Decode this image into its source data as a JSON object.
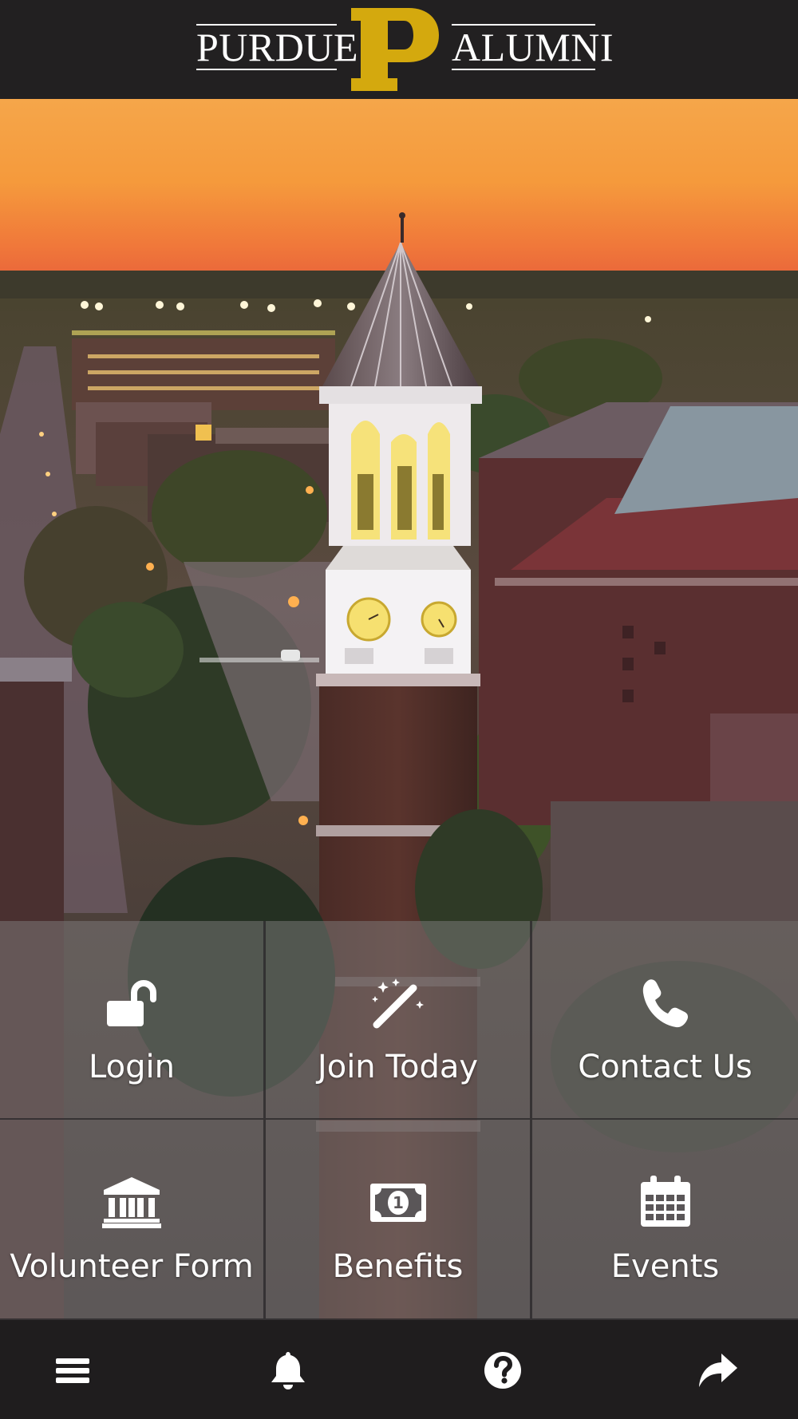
{
  "header": {
    "logo": {
      "left_word": "PURDUE",
      "right_word": "ALUMNI",
      "monogram": "P",
      "icon": "purdue-p-logo"
    }
  },
  "hero": {
    "icon": "bell-tower-photo"
  },
  "tiles": [
    {
      "label": "Login",
      "icon": "unlocked-padlock-icon"
    },
    {
      "label": "Join Today",
      "icon": "magic-wand-icon"
    },
    {
      "label": "Contact Us",
      "icon": "phone-icon"
    },
    {
      "label": "Volunteer Form",
      "icon": "institution-building-icon"
    },
    {
      "label": "Benefits",
      "icon": "dollar-bill-icon"
    },
    {
      "label": "Events",
      "icon": "calendar-icon"
    }
  ],
  "bottombar": {
    "items": [
      {
        "icon": "hamburger-menu-icon"
      },
      {
        "icon": "bell-icon"
      },
      {
        "icon": "help-question-icon"
      },
      {
        "icon": "share-arrow-icon"
      }
    ]
  },
  "colors": {
    "header_bg": "#222021",
    "brand_gold": "#d4a90e",
    "tile_overlay": "rgba(128,126,126,0.5)",
    "bottombar_bg": "#1f1d1e",
    "text": "#ffffff"
  }
}
